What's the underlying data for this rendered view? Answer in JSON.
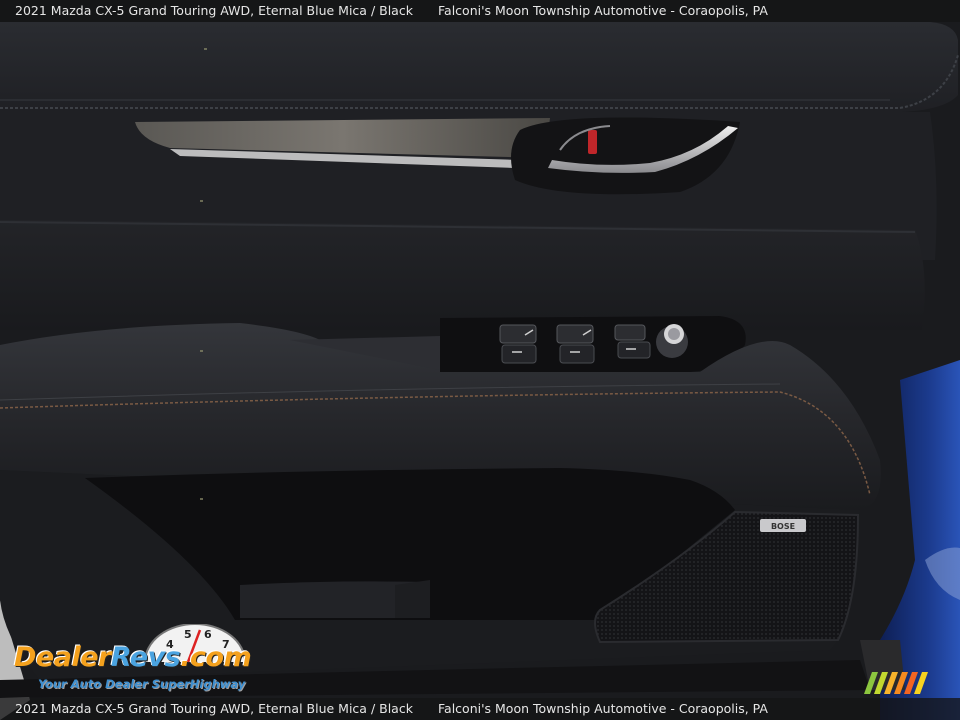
{
  "caption": {
    "vehicle": "2021 Mazda CX-5 Grand Touring AWD,  Eternal Blue Mica / Black",
    "dealer": "Falconi's Moon Township Automotive - Coraopolis, PA"
  },
  "badge": {
    "speaker_brand": "BOSE"
  },
  "watermark": {
    "brand_part1": "Dealer",
    "brand_part2": "Revs",
    "brand_part3": ".com",
    "tagline": "Your Auto Dealer SuperHighway",
    "gauge_numbers": [
      "4",
      "5",
      "6",
      "7"
    ]
  },
  "colors": {
    "door_panel": "#1e1f23",
    "exterior_blue": "#1b3a8c",
    "logo_orange": "#f4a11d",
    "logo_blue": "#4aa3e0"
  }
}
